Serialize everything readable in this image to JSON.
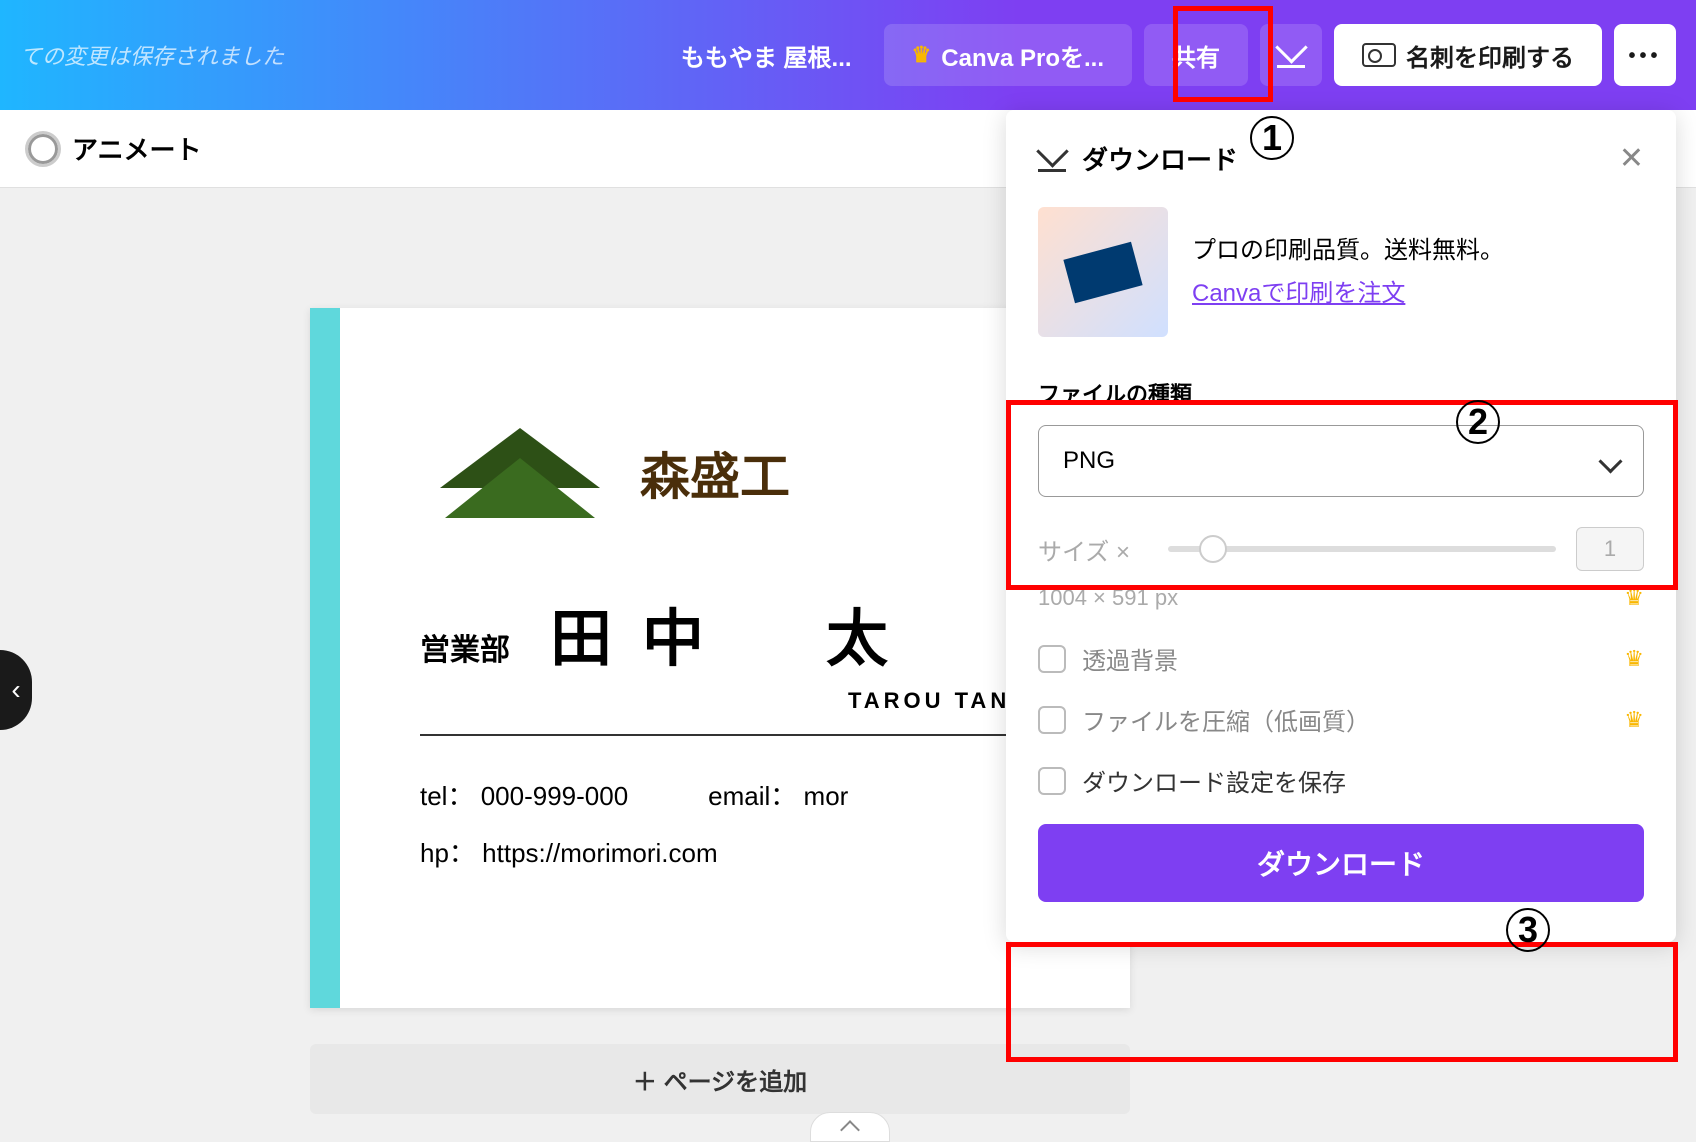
{
  "header": {
    "save_status": "ての変更は保存されました",
    "doc_title": "ももやま 屋根...",
    "canva_pro": "Canva Proを...",
    "share": "共有",
    "print_card": "名刺を印刷する"
  },
  "subheader": {
    "animate": "アニメート"
  },
  "card": {
    "company": "森盛工",
    "dept": "営業部",
    "name": "田中　太",
    "romaji": "TAROU TANAK",
    "tel_label": "tel：",
    "tel": "000-999-000",
    "email_label": "email：",
    "email": "mor",
    "hp_label": "hp：",
    "hp": "https://morimori.com"
  },
  "add_page": "＋ ページを追加",
  "panel": {
    "title": "ダウンロード",
    "promo_text": "プロの印刷品質。送料無料。",
    "promo_link": "Canvaで印刷を注文",
    "file_type_label": "ファイルの種類",
    "file_type_value": "PNG",
    "size_label": "サイズ ×",
    "size_value": "1",
    "dimensions": "1004 × 591 px",
    "transparent_bg": "透過背景",
    "compress": "ファイルを圧縮（低画質）",
    "save_settings": "ダウンロード設定を保存",
    "download_btn": "ダウンロード"
  },
  "annotations": {
    "one": "1",
    "two": "2",
    "three": "3"
  }
}
